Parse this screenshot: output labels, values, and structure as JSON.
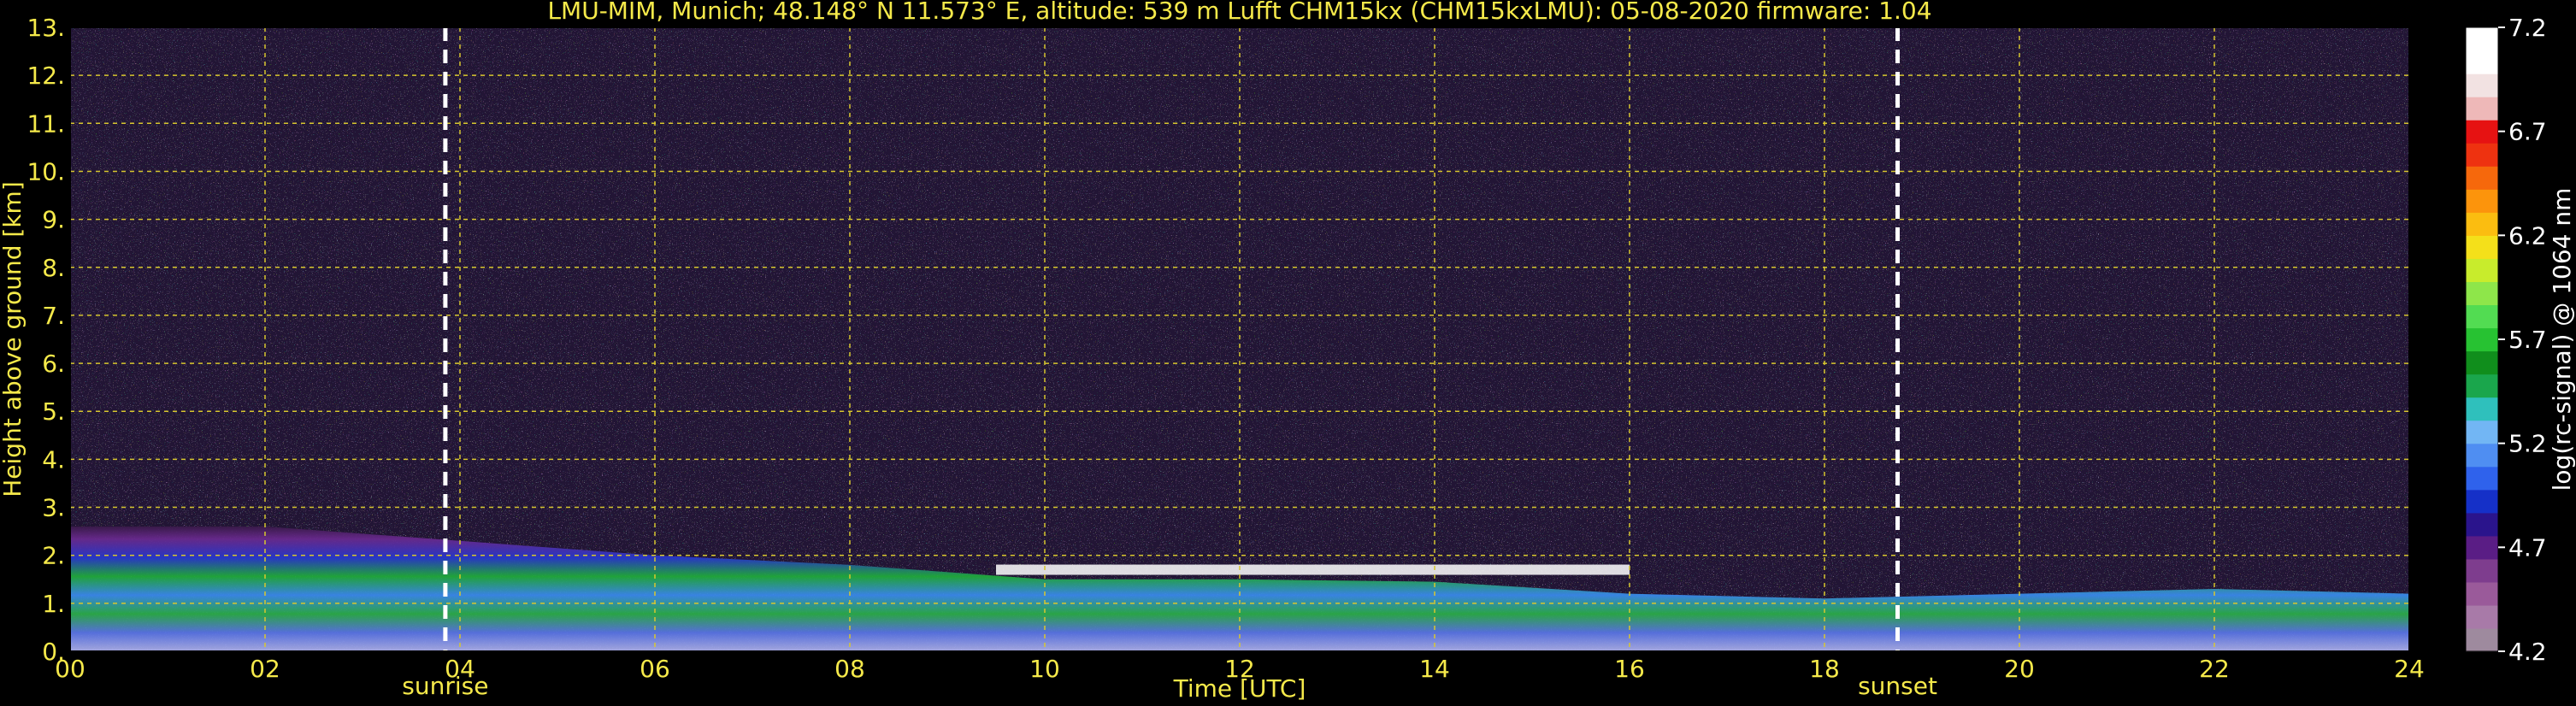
{
  "chart_data": {
    "type": "heatmap",
    "title": "LMU-MIM, Munich; 48.148° N 11.573° E, altitude: 539 m    Lufft CHM15kx (CHM15kxLMU): 05-08-2020    firmware: 1.04",
    "xlabel": "Time [UTC]",
    "ylabel": "Height above ground [km]",
    "xlim": [
      0,
      24
    ],
    "ylim": [
      0,
      13
    ],
    "x_ticks": [
      "00",
      "02",
      "04",
      "06",
      "08",
      "10",
      "12",
      "14",
      "16",
      "18",
      "20",
      "22",
      "24"
    ],
    "y_ticks": [
      "0.",
      "1.",
      "2.",
      "3.",
      "4.",
      "5.",
      "6.",
      "7.",
      "8.",
      "9.",
      "10.",
      "11.",
      "12.",
      "13."
    ],
    "grid": true,
    "markers": [
      {
        "label": "sunrise",
        "x": 3.85
      },
      {
        "label": "sunset",
        "x": 18.75
      }
    ],
    "colorbar": {
      "label": "log(rc-signal) @ 1064 nm",
      "range": [
        4.2,
        7.2
      ],
      "ticks": [
        "4.2",
        "4.7",
        "5.2",
        "5.7",
        "6.2",
        "6.7",
        "7.2"
      ],
      "colors": [
        "#9e8a9e",
        "#a87aa8",
        "#9a5a9a",
        "#7e3d8e",
        "#5a1d85",
        "#2a148c",
        "#1530c8",
        "#2f62ec",
        "#4f8ef2",
        "#72b6f4",
        "#2fc0bc",
        "#1aa64c",
        "#108e1c",
        "#27c232",
        "#52dc52",
        "#8ee64a",
        "#c8ec2c",
        "#f4e01a",
        "#fbbd10",
        "#fc940c",
        "#f6680c",
        "#ee3210",
        "#e61212",
        "#eeb8b8",
        "#f2e2e2",
        "#ffffff",
        "#ffffff"
      ]
    },
    "layers": [
      {
        "name": "boundary layer",
        "x_range": [
          0,
          24
        ],
        "top_km": [
          2.6,
          2.6,
          2.3,
          2.0,
          1.8,
          1.5,
          1.5,
          1.45,
          1.2,
          1.1,
          1.2,
          1.3,
          1.2
        ]
      },
      {
        "name": "cloud base",
        "x_range": [
          9.5,
          16
        ],
        "height_km": 1.7
      }
    ]
  },
  "colors": {
    "background": "#000000",
    "text": "#f5e94a",
    "grid": "#d8c72e",
    "marker": "#ffffff"
  }
}
